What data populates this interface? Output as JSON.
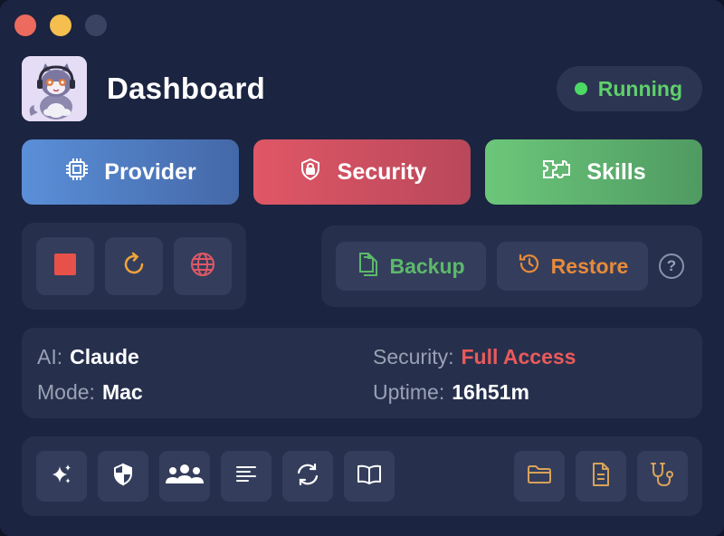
{
  "window": {
    "controls": [
      "close",
      "minimize",
      "zoom"
    ]
  },
  "header": {
    "title": "Dashboard",
    "avatar_icon": "cat-avatar",
    "status": {
      "label": "Running",
      "color": "#5fd06b"
    }
  },
  "nav": [
    {
      "label": "Provider",
      "icon": "chip-icon",
      "color": "#5a8fd8"
    },
    {
      "label": "Security",
      "icon": "shield-lock-icon",
      "color": "#e05766"
    },
    {
      "label": "Skills",
      "icon": "puzzle-icon",
      "color": "#6cc77a"
    }
  ],
  "controls": [
    {
      "icon": "stop-icon",
      "color": "#e8504a"
    },
    {
      "icon": "restart-icon",
      "color": "#f2a43a"
    },
    {
      "icon": "globe-icon",
      "color": "#e05766"
    }
  ],
  "backup": {
    "backup_label": "Backup",
    "restore_label": "Restore",
    "help_label": "?",
    "backup_color": "#5cb96a",
    "restore_color": "#e88a3a"
  },
  "info": {
    "ai_label": "AI:",
    "ai_value": "Claude",
    "mode_label": "Mode:",
    "mode_value": "Mac",
    "security_label": "Security:",
    "security_value": "Full Access",
    "uptime_label": "Uptime:",
    "uptime_value": "16h51m"
  },
  "tools": {
    "left": [
      "sparkles-icon",
      "shield-icon",
      "users-icon",
      "lines-icon",
      "sync-icon",
      "book-icon"
    ],
    "right": [
      "folder-icon",
      "document-icon",
      "stethoscope-icon"
    ],
    "right_color": "#d9a25a"
  }
}
